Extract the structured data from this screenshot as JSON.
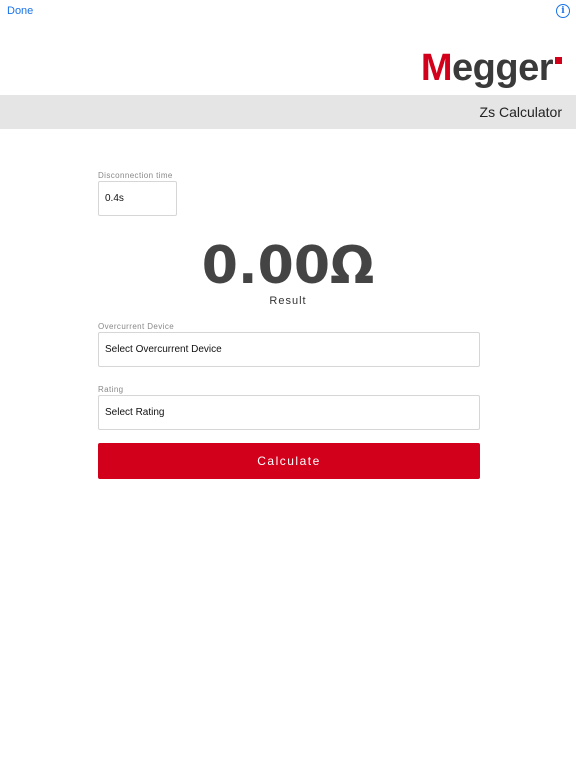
{
  "nav": {
    "done_label": "Done",
    "info_glyph": "i"
  },
  "logo": {
    "first_letter": "M",
    "rest": "egger",
    "mark": "R",
    "brand_red": "#d3001c",
    "brand_gray": "#3a3a3a"
  },
  "title_bar": {
    "title": "Zs Calculator"
  },
  "disconnection_time": {
    "label": "Disconnection time",
    "value": "0.4s"
  },
  "result": {
    "value": "0.00Ω",
    "label": "Result"
  },
  "overcurrent_device": {
    "label": "Overcurrent Device",
    "value": "Select Overcurrent Device"
  },
  "rating": {
    "label": "Rating",
    "value": "Select Rating"
  },
  "calculate": {
    "label": "Calculate"
  },
  "icons": {
    "info": "info-icon"
  }
}
